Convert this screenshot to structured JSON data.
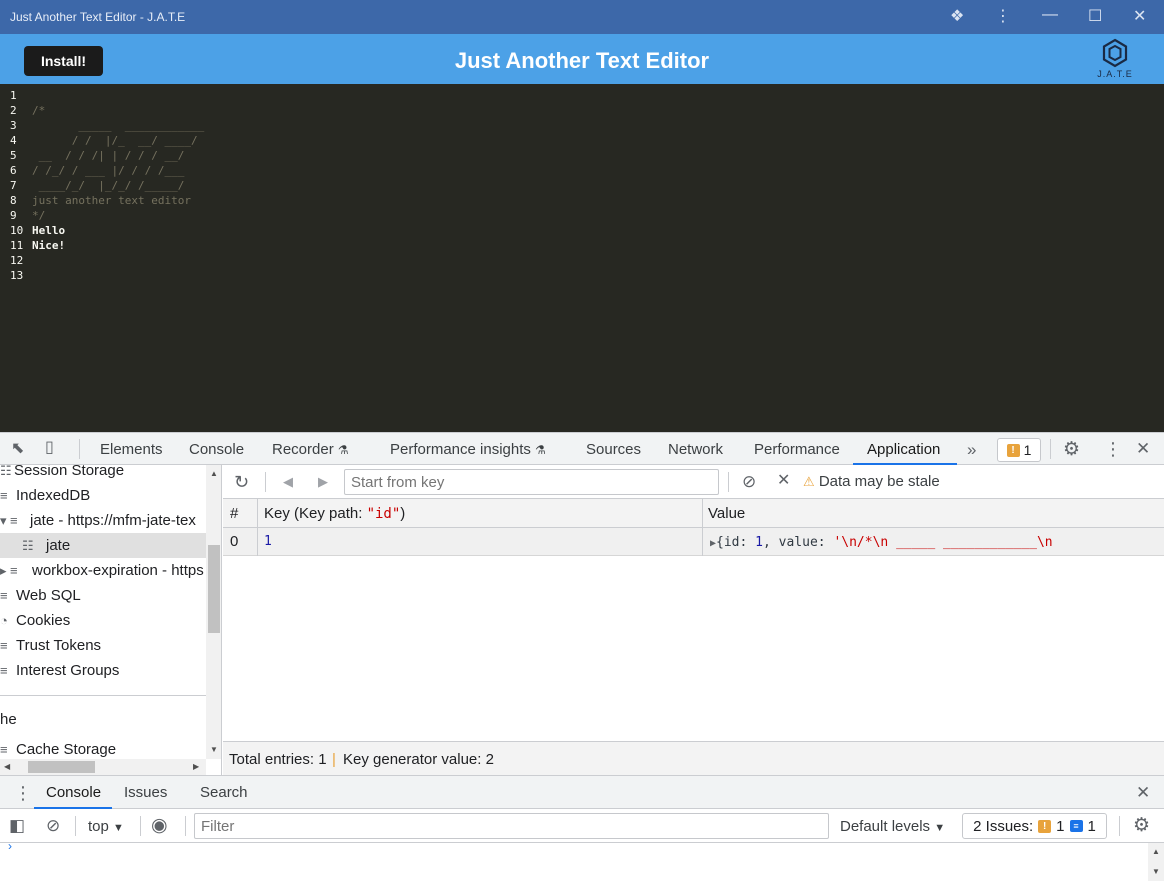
{
  "window": {
    "title": "Just Another Text Editor - J.A.T.E"
  },
  "app": {
    "install_label": "Install!",
    "title": "Just Another Text Editor",
    "logo_label": "J.A.T.E"
  },
  "editor": {
    "lines": [
      {
        "n": "1",
        "text": ""
      },
      {
        "n": "2",
        "text": "/*"
      },
      {
        "n": "3",
        "text": "       _____  ____________"
      },
      {
        "n": "4",
        "text": "      / /  |/_  __/ ____/"
      },
      {
        "n": "5",
        "text": " __  / / /| | / / / __/"
      },
      {
        "n": "6",
        "text": "/ /_/ / ___ |/ / / /___"
      },
      {
        "n": "7",
        "text": " ____/_/  |_/_/ /_____/"
      },
      {
        "n": "8",
        "text": "just another text editor"
      },
      {
        "n": "9",
        "text": "*/"
      },
      {
        "n": "10",
        "text": "Hello"
      },
      {
        "n": "11",
        "text": "Nice!"
      },
      {
        "n": "12",
        "text": ""
      },
      {
        "n": "13",
        "text": ""
      }
    ]
  },
  "devtools": {
    "tabs": [
      "Elements",
      "Console",
      "Recorder",
      "Performance insights",
      "Sources",
      "Network",
      "Performance",
      "Application"
    ],
    "active_tab": "Application",
    "issues_count": "1",
    "sidebar": [
      {
        "label": "Session Storage",
        "icon": "grid-icon"
      },
      {
        "label": "IndexedDB",
        "icon": "database-icon"
      },
      {
        "label": "jate - https://mfm-jate-tex",
        "icon": "database-icon"
      },
      {
        "label": "jate",
        "icon": "table-icon"
      },
      {
        "label": "workbox-expiration - https",
        "icon": "database-icon"
      },
      {
        "label": "Web SQL",
        "icon": "database-icon"
      },
      {
        "label": "Cookies",
        "icon": "cookie-icon"
      },
      {
        "label": "Trust Tokens",
        "icon": "database-icon"
      },
      {
        "label": "Interest Groups",
        "icon": "database-icon"
      },
      {
        "label": "he",
        "icon": ""
      },
      {
        "label": "Cache Storage",
        "icon": "database-icon"
      }
    ],
    "toolbar": {
      "key_placeholder": "Start from key",
      "stale_text": "Data may be stale"
    },
    "table": {
      "headers": {
        "index": "#",
        "key": "Key (Key path: ",
        "key_path": "\"id\"",
        "key_close": ")",
        "value": "Value"
      },
      "rows": [
        {
          "index": "0",
          "key": "1",
          "value_prefix": "{id: ",
          "value_id": "1",
          "value_mid": ", value: ",
          "value_str": "'\\n/*\\n       _____  ____________\\n"
        }
      ]
    },
    "summary": {
      "entries": "Total entries: 1",
      "generator": "Key generator value: 2"
    },
    "drawer": {
      "tabs": [
        "Console",
        "Issues",
        "Search"
      ],
      "active_tab": "Console",
      "context": "top",
      "filter_placeholder": "Filter",
      "levels": "Default levels",
      "issues_label": "2 Issues:",
      "issues_warn": "1",
      "issues_info": "1"
    }
  },
  "colors": {
    "titlebar": "#3d68a9",
    "header": "#4ca1e7",
    "editor_bg": "#272822",
    "accent": "#1a73e8"
  }
}
